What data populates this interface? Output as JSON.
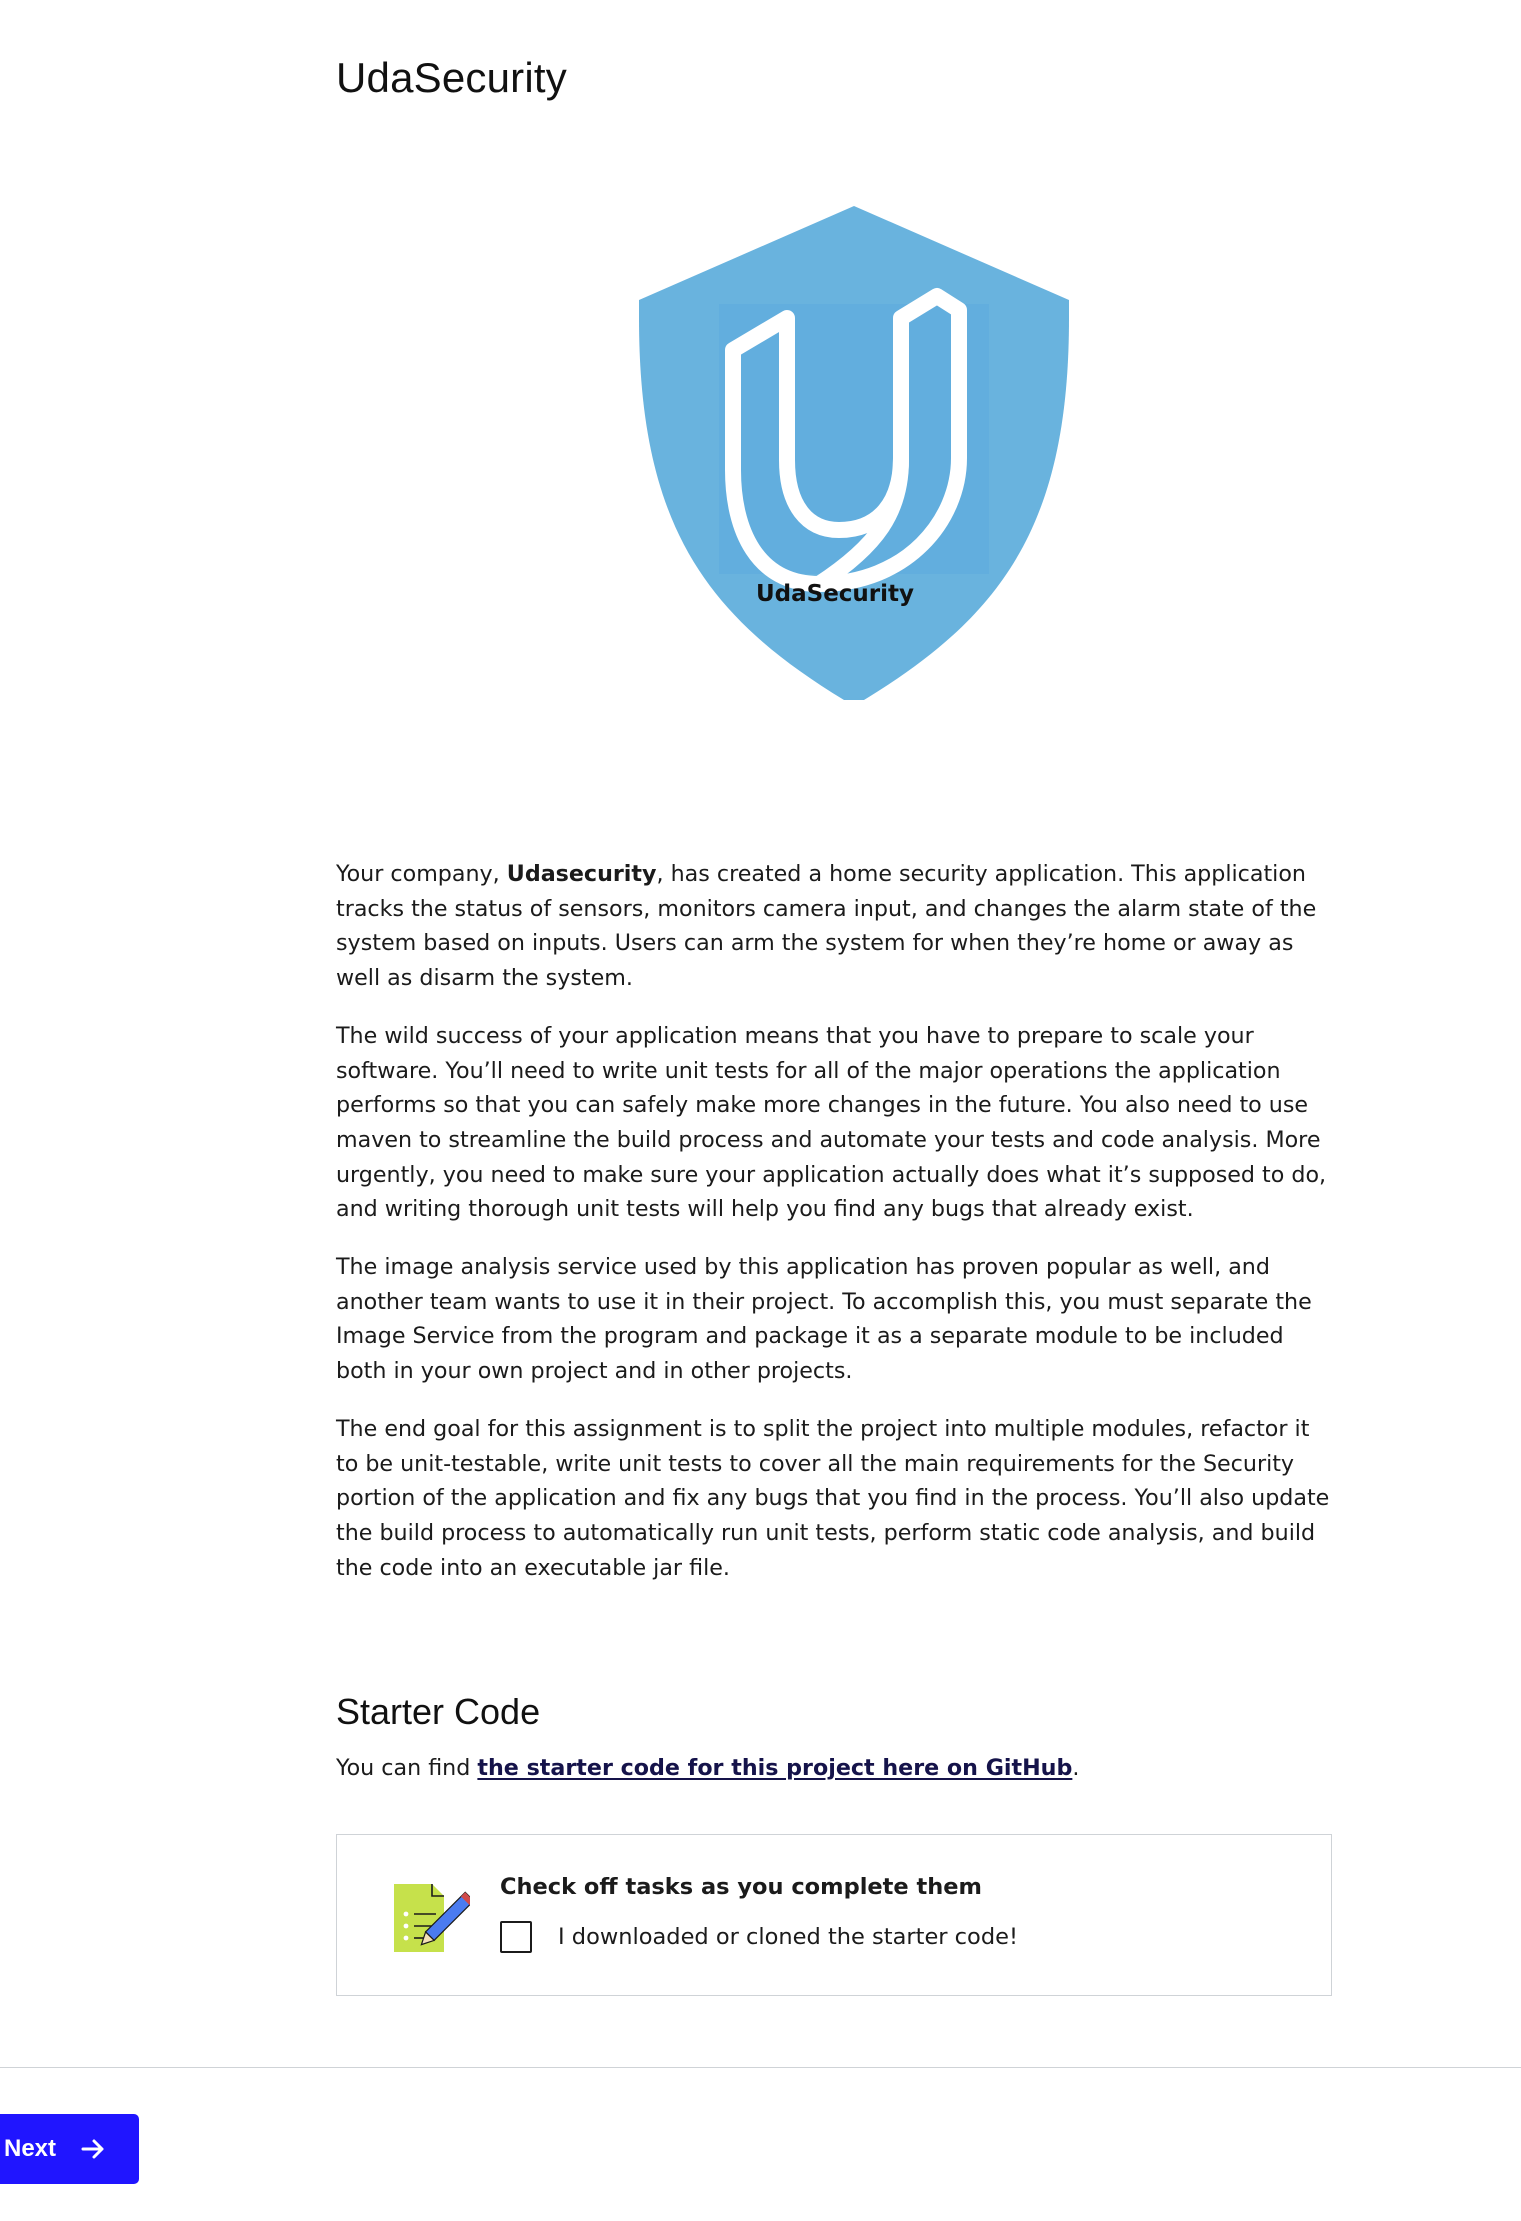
{
  "page": {
    "title": "UdaSecurity"
  },
  "figure": {
    "caption": "UdaSecurity",
    "colors": {
      "shield": "#69b3de",
      "shield_inner": "#62aede",
      "logo_stroke": "#ffffff"
    },
    "icon": "udacity-shield-logo"
  },
  "intro": {
    "p1_before": "Your company, ",
    "p1_bold": "Udasecurity",
    "p1_after": ", has created a home security application. This application tracks the status of sensors, monitors camera input, and changes the alarm state of the system based on inputs. Users can arm the system for when they’re home or away as well as disarm the system.",
    "p2": "The wild success of your application means that you have to prepare to scale your software. You’ll need to write unit tests for all of the major operations the application performs so that you can safely make more changes in the future. You also need to use maven to streamline the build process and automate your tests and code analysis. More urgently, you need to make sure your application actually does what it’s supposed to do, and writing thorough unit tests will help you find any bugs that already exist.",
    "p3": "The image analysis service used by this application has proven popular as well, and another team wants to use it in their project. To accomplish this, you must separate the Image Service from the program and package it as a separate module to be included both in your own project and in other projects.",
    "p4": "The end goal for this assignment is to split the project into multiple modules, refactor it to be unit-testable, write unit tests to cover all the main requirements for the Security portion of the application and fix any bugs that you find in the process. You’ll also update the build process to automatically run unit tests, perform static code analysis, and build the code into an executable jar file."
  },
  "starter": {
    "heading": "Starter Code",
    "text_before": "You can find ",
    "link_text": "the starter code for this project here on GitHub",
    "text_after": ".",
    "link_color": "#15134a"
  },
  "tasks": {
    "heading": "Check off tasks as you complete them",
    "icon": "checklist-pencil-icon",
    "items": [
      {
        "label": "I downloaded or cloned the starter code!",
        "checked": false
      }
    ]
  },
  "footer": {
    "next_label": "Next",
    "next_icon": "arrow-right-icon",
    "accent": "#2015ff"
  }
}
